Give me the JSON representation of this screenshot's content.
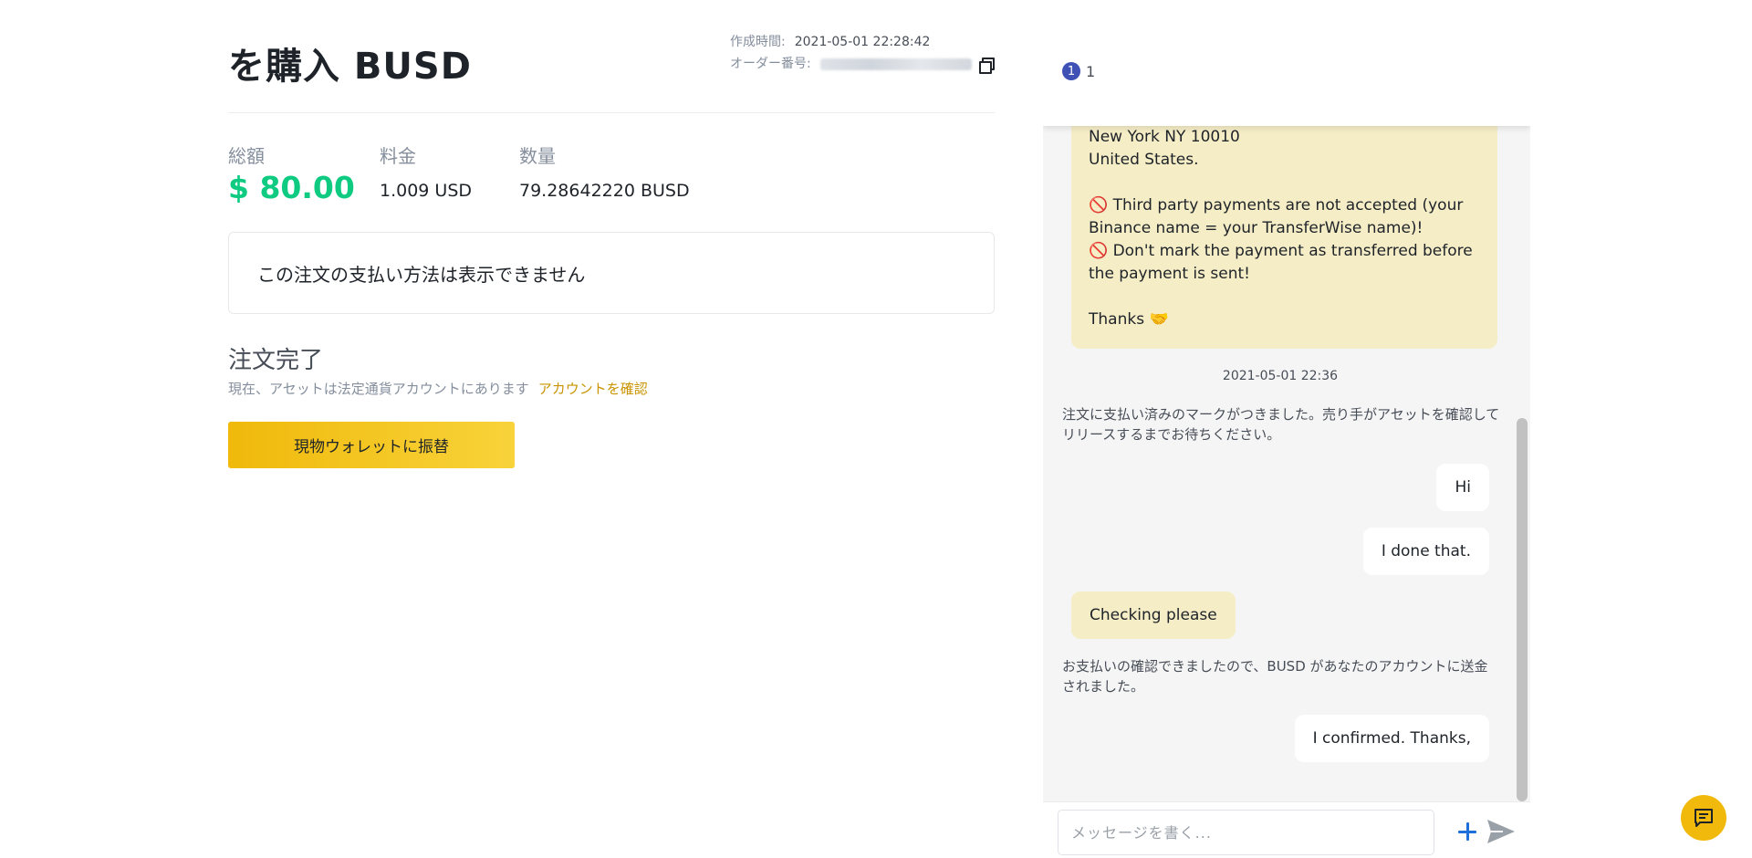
{
  "order": {
    "title": "を購入 BUSD",
    "created_label": "作成時間:",
    "created_value": "2021-05-01 22:28:42",
    "order_no_label": "オーダー番号:",
    "total_label": "総額",
    "total_value": "$ 80.00",
    "fee_label": "料金",
    "fee_value": "1.009 USD",
    "qty_label": "数量",
    "qty_value": "79.28642220 BUSD",
    "payment_notice": "この注文の支払い方法は表示できません",
    "complete_title": "注文完了",
    "complete_sub": "現在、アセットは法定通貨アカウントにあります",
    "check_account_link": "アカウントを確認",
    "transfer_button": "現物ウォレットに振替"
  },
  "chat": {
    "header_badge": "1",
    "header_count": "1",
    "pinned_message": "New York NY 10010\nUnited States.\n\n🚫 Third party payments are not accepted (your Binance name = your TransferWise name)!\n🚫 Don't mark the payment as transferred before the payment is sent!\n\nThanks 🤝",
    "timestamp": "2021-05-01 22:36",
    "system_1": "注文に支払い済みのマークがつきました。売り手がアセットを確認してリリースするまでお待ちください。",
    "msg_hi": "Hi",
    "msg_done": "I done that.",
    "msg_checking": "Checking please",
    "system_2": "お支払いの確認できましたので、BUSD があなたのアカウントに送金されました。",
    "msg_confirmed": "I confirmed. Thanks,",
    "input_placeholder": "メッセージを書く..."
  },
  "icons": {
    "copy": "copy-icon",
    "plus": "plus-icon",
    "send": "send-icon",
    "help": "chat-help-icon"
  },
  "colors": {
    "accent": "#f0b90b",
    "total_green": "#0ecb81",
    "link": "#c99400",
    "badge": "#3f51b5"
  }
}
